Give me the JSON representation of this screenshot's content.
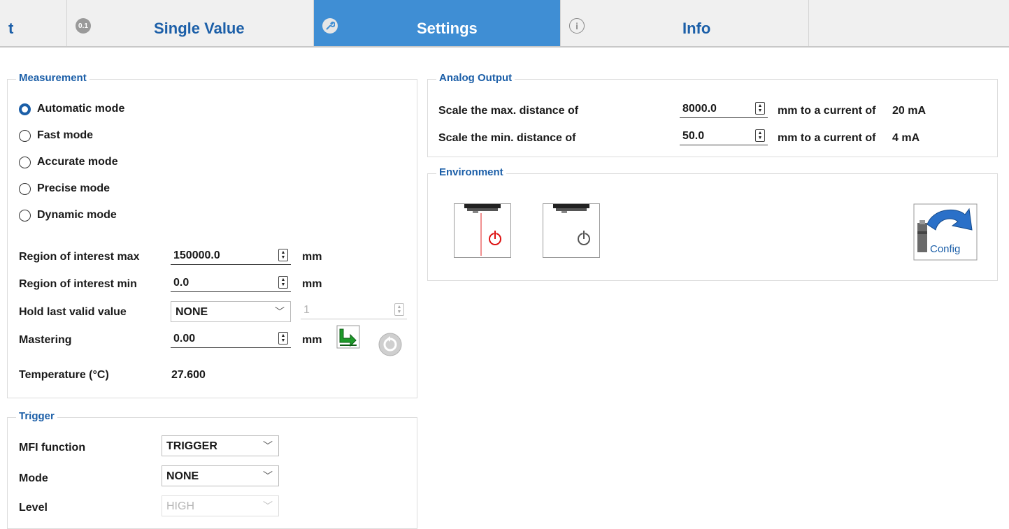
{
  "tabs": [
    {
      "label": "t",
      "icon": "truncated-tab"
    },
    {
      "label": "Single Value",
      "icon": "single-value-icon",
      "icon_text": "0.1"
    },
    {
      "label": "Settings",
      "icon": "settings-wrench-icon",
      "active": true
    },
    {
      "label": "Info",
      "icon": "info-icon",
      "icon_text": "i"
    }
  ],
  "measurement": {
    "title": "Measurement",
    "modes": [
      {
        "label": "Automatic mode",
        "checked": true
      },
      {
        "label": "Fast mode",
        "checked": false
      },
      {
        "label": "Accurate mode",
        "checked": false
      },
      {
        "label": "Precise mode",
        "checked": false
      },
      {
        "label": "Dynamic mode",
        "checked": false
      }
    ],
    "roi_max": {
      "label": "Region of interest max",
      "value": "150000.0",
      "unit": "mm"
    },
    "roi_min": {
      "label": "Region of interest min",
      "value": "0.0",
      "unit": "mm"
    },
    "hold": {
      "label": "Hold last valid value",
      "value": "NONE",
      "count": "1"
    },
    "mastering": {
      "label": "Mastering",
      "value": "0.00",
      "unit": "mm"
    },
    "temperature": {
      "label": "Temperature (°C)",
      "value": "27.600"
    }
  },
  "trigger": {
    "title": "Trigger",
    "mfi": {
      "label": "MFI function",
      "value": "TRIGGER"
    },
    "mode": {
      "label": "Mode",
      "value": "NONE"
    },
    "level": {
      "label": "Level",
      "value": "HIGH"
    }
  },
  "analog": {
    "title": "Analog Output",
    "max": {
      "label": "Scale the max. distance of",
      "value": "8000.0",
      "suffix": "mm to a current of",
      "current": "20 mA"
    },
    "min": {
      "label": "Scale the min. distance of",
      "value": "50.0",
      "suffix": "mm to a current of",
      "current": "4 mA"
    }
  },
  "environment": {
    "title": "Environment",
    "config_label": "Config"
  },
  "colors": {
    "accent": "#3f8ed4",
    "title_blue": "#1c5fa8",
    "laser_red": "#e02020"
  }
}
